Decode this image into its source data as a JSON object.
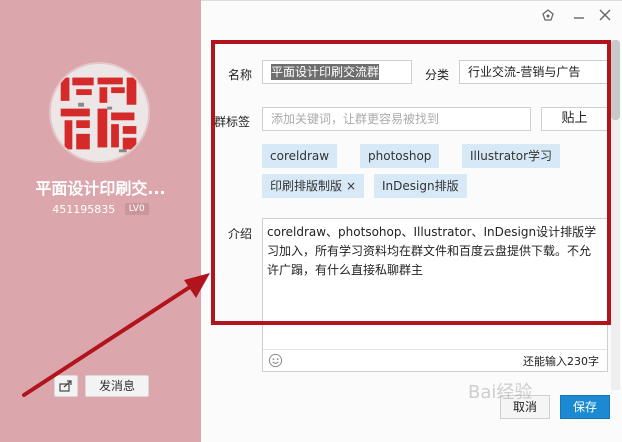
{
  "group": {
    "name": "平面设计印刷交...",
    "id": "451195835",
    "level": "LV0"
  },
  "left_actions": {
    "send_message_label": "发消息"
  },
  "form": {
    "name_label": "名称",
    "name_value": "平面设计印刷交流群",
    "category_label": "分类",
    "category_value": "行业交流-营销与广告",
    "tags_label": "群标签",
    "tags_placeholder": "添加关键词，让群更容易被找到",
    "paste_label": "贴上",
    "tags": [
      {
        "label": "coreldraw"
      },
      {
        "label": "photoshop"
      },
      {
        "label": "Illustrator学习"
      },
      {
        "label": "印刷排版制版",
        "close": "×"
      },
      {
        "label": "InDesign排版"
      }
    ],
    "intro_label": "介绍",
    "intro_value": "coreldraw、photsohop、Illustrator、InDesign设计排版学习加入，所有学习资料均在群文件和百度云盘提供下载。不允许广蹋，有什么直接私聊群主",
    "remaining_text": "还能输入230字"
  },
  "buttons": {
    "cancel_label": "取消",
    "save_label": "保存"
  },
  "watermark": "Bai经验",
  "colors": {
    "left_panel": "#dba7ac",
    "accent_blue": "#1b8ad3",
    "annotation_red": "#b1141d",
    "tag_bg": "#d7e9f7"
  }
}
